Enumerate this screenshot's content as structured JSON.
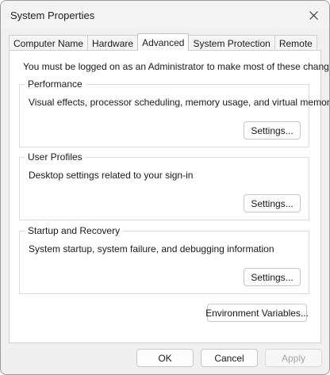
{
  "window": {
    "title": "System Properties"
  },
  "tabs": [
    {
      "label": "Computer Name",
      "active": false
    },
    {
      "label": "Hardware",
      "active": false
    },
    {
      "label": "Advanced",
      "active": true
    },
    {
      "label": "System Protection",
      "active": false
    },
    {
      "label": "Remote",
      "active": false
    }
  ],
  "advanced": {
    "notice": "You must be logged on as an Administrator to make most of these changes.",
    "performance": {
      "legend": "Performance",
      "description": "Visual effects, processor scheduling, memory usage, and virtual memory",
      "button": "Settings..."
    },
    "user_profiles": {
      "legend": "User Profiles",
      "description": "Desktop settings related to your sign-in",
      "button": "Settings..."
    },
    "startup_recovery": {
      "legend": "Startup and Recovery",
      "description": "System startup, system failure, and debugging information",
      "button": "Settings..."
    },
    "env_button": "Environment Variables..."
  },
  "footer": {
    "ok": "OK",
    "cancel": "Cancel",
    "apply": "Apply"
  },
  "icons": {
    "close": "close-icon"
  }
}
